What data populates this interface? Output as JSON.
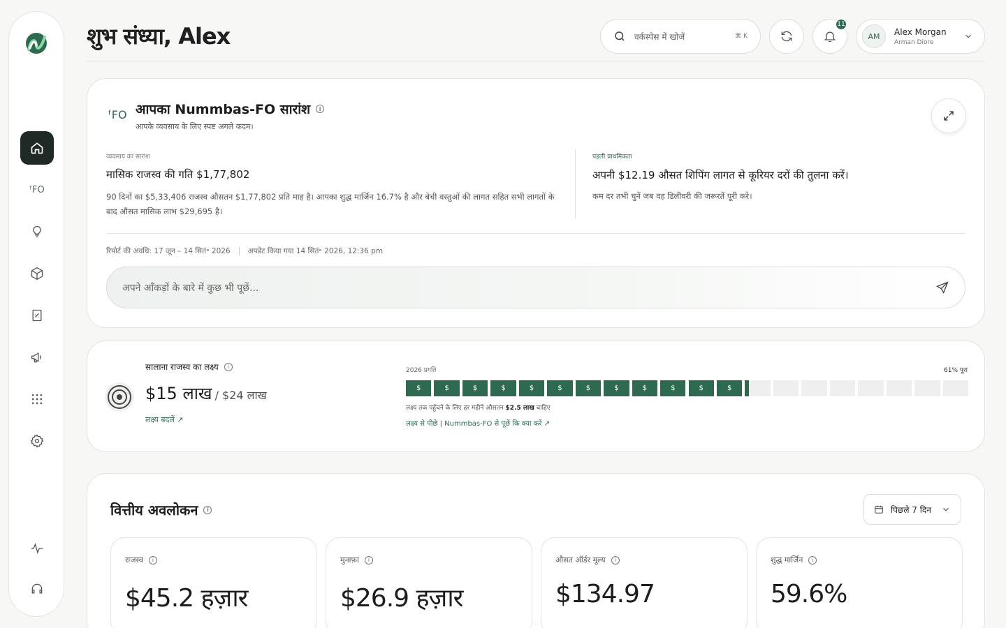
{
  "header": {
    "greeting": "शुभ संध्या, Alex",
    "search_placeholder": "वर्कस्पेस में खोजें",
    "search_shortcut": "⌘ K",
    "notification_count": "11",
    "user": {
      "initials": "AM",
      "name": "Alex Morgan",
      "org": "Arman Diore"
    }
  },
  "sidebar": {
    "items": [
      {
        "name": "home",
        "icon": "home-icon"
      },
      {
        "name": "fo",
        "icon": "fo-icon",
        "glyph": "ᶠFO"
      },
      {
        "name": "insights",
        "icon": "lightbulb-icon"
      },
      {
        "name": "products",
        "icon": "box-icon"
      },
      {
        "name": "reports",
        "icon": "report-icon"
      },
      {
        "name": "marketing",
        "icon": "megaphone-icon"
      },
      {
        "name": "apps",
        "icon": "grid-icon"
      },
      {
        "name": "settings",
        "icon": "gear-icon"
      },
      {
        "name": "activity",
        "icon": "pulse-icon"
      },
      {
        "name": "support",
        "icon": "headset-icon"
      }
    ]
  },
  "summary": {
    "title": "आपका Nummbas-FO सारांश",
    "subtitle": "आपके व्यवसाय के लिए स्पष्ट अगले कदम।",
    "left": {
      "label": "व्यवसाय का सारांश",
      "heading": "मासिक राजस्व की गति $1,77,802",
      "body": "90 दिनों का $5,33,406 राजस्व औसतन $1,77,802 प्रति माह है। आपका शुद्ध मार्जिन 16.7% है और बेची वस्तुओं की लागत सहित सभी लागतों के बाद औसत मासिक लाभ $29,695 है।"
    },
    "right": {
      "label": "पहली प्राथमिकता",
      "heading": "अपनी $12.19 औसत शिपिंग लागत से कूरियर दरों की तुलना करें।",
      "body": "कम दर तभी चुनें जब वह डिलीवरी की जरूरतें पूरी करे।"
    },
    "report_period": "रिपोर्ट की अवधि: 17 जून – 14 सितं॰ 2026",
    "updated": "अपडेट किया गया 14 सितं॰ 2026, 12:36 pm",
    "ask_placeholder": "अपने आँकड़ों के बारे में कुछ भी पूछें..."
  },
  "goal": {
    "label": "सालाना राजस्व का लक्ष्य",
    "current": "$15 लाख",
    "target": "/ $24 लाख",
    "change_link": "लक्ष्य बदलें ↗",
    "progress_label": "2026 प्रगति",
    "progress_pct_text": "61% पूरा",
    "progress_fraction": 0.61,
    "segment_symbol": "$",
    "segments_total": 20,
    "note_prefix": "लक्ष्य तक पहुँचने के लिए हर महीने औसतन ",
    "note_amount": "$2.5 लाख",
    "note_suffix": " चाहिए",
    "ask_link": "लक्ष्य से पीछे | Nummbas-FO से पूछें कि क्या करें ↗"
  },
  "financial": {
    "title": "वित्तीय अवलोकन",
    "range": "पिछले 7 दिन",
    "kpis": [
      {
        "label": "राजस्व",
        "value": "$45.2 हज़ार"
      },
      {
        "label": "मुनाफ़ा",
        "value": "$26.9 हज़ार"
      },
      {
        "label": "औसत ऑर्डर मूल्य",
        "value": "$134.97"
      },
      {
        "label": "शुद्ध मार्जिन",
        "value": "59.6%"
      }
    ]
  },
  "colors": {
    "accent": "#2d6a4f",
    "sidebar_active": "#1f2a27"
  }
}
